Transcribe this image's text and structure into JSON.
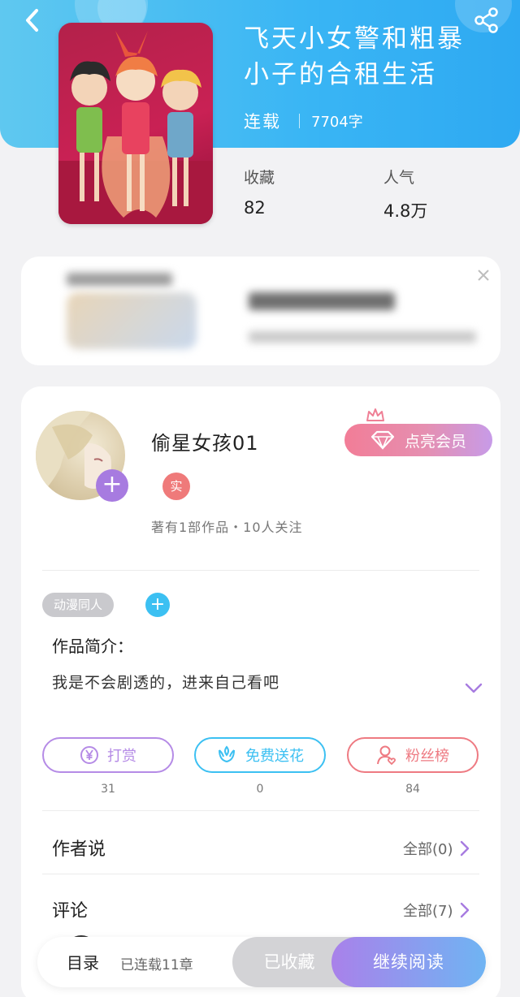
{
  "header": {
    "back_icon": "chevron-left-icon",
    "share_icon": "share-icon"
  },
  "book": {
    "title": "飞天小女警和粗暴小子的合租生活",
    "status": "连载",
    "word_count": "7704字",
    "stats": [
      {
        "label": "收藏",
        "value": "82"
      },
      {
        "label": "人气",
        "value": "4.8万"
      }
    ]
  },
  "author": {
    "name": "偷星女孩01",
    "verified_badge": "实",
    "meta": "著有1部作品・10人关注",
    "vip_button": "点亮会员"
  },
  "tags": {
    "items": [
      "动漫同人"
    ],
    "add_label": "+"
  },
  "intro": {
    "label": "作品简介：",
    "text": "我是不会剧透的，进来自己看吧"
  },
  "actions": [
    {
      "label": "打赏",
      "count": "31",
      "color": "#b58be6",
      "icon": "yen-coin-icon"
    },
    {
      "label": "免费送花",
      "count": "0",
      "color": "#3cc0f2",
      "icon": "flower-icon"
    },
    {
      "label": "粉丝榜",
      "count": "84",
      "color": "#ee7a82",
      "icon": "fan-user-icon"
    }
  ],
  "sections": {
    "author_says": {
      "label": "作者说",
      "link": "全部(0)"
    },
    "comments": {
      "label": "评论",
      "link": "全部(7)"
    }
  },
  "bottom_bar": {
    "toc_label": "目录",
    "toc_sub": "已连载11章",
    "favorite_label": "已收藏",
    "read_label": "继续阅读"
  },
  "colors": {
    "header_blue": "#39b5f4",
    "accent_purple": "#a77be0",
    "vip_pink": "#f27d97"
  }
}
